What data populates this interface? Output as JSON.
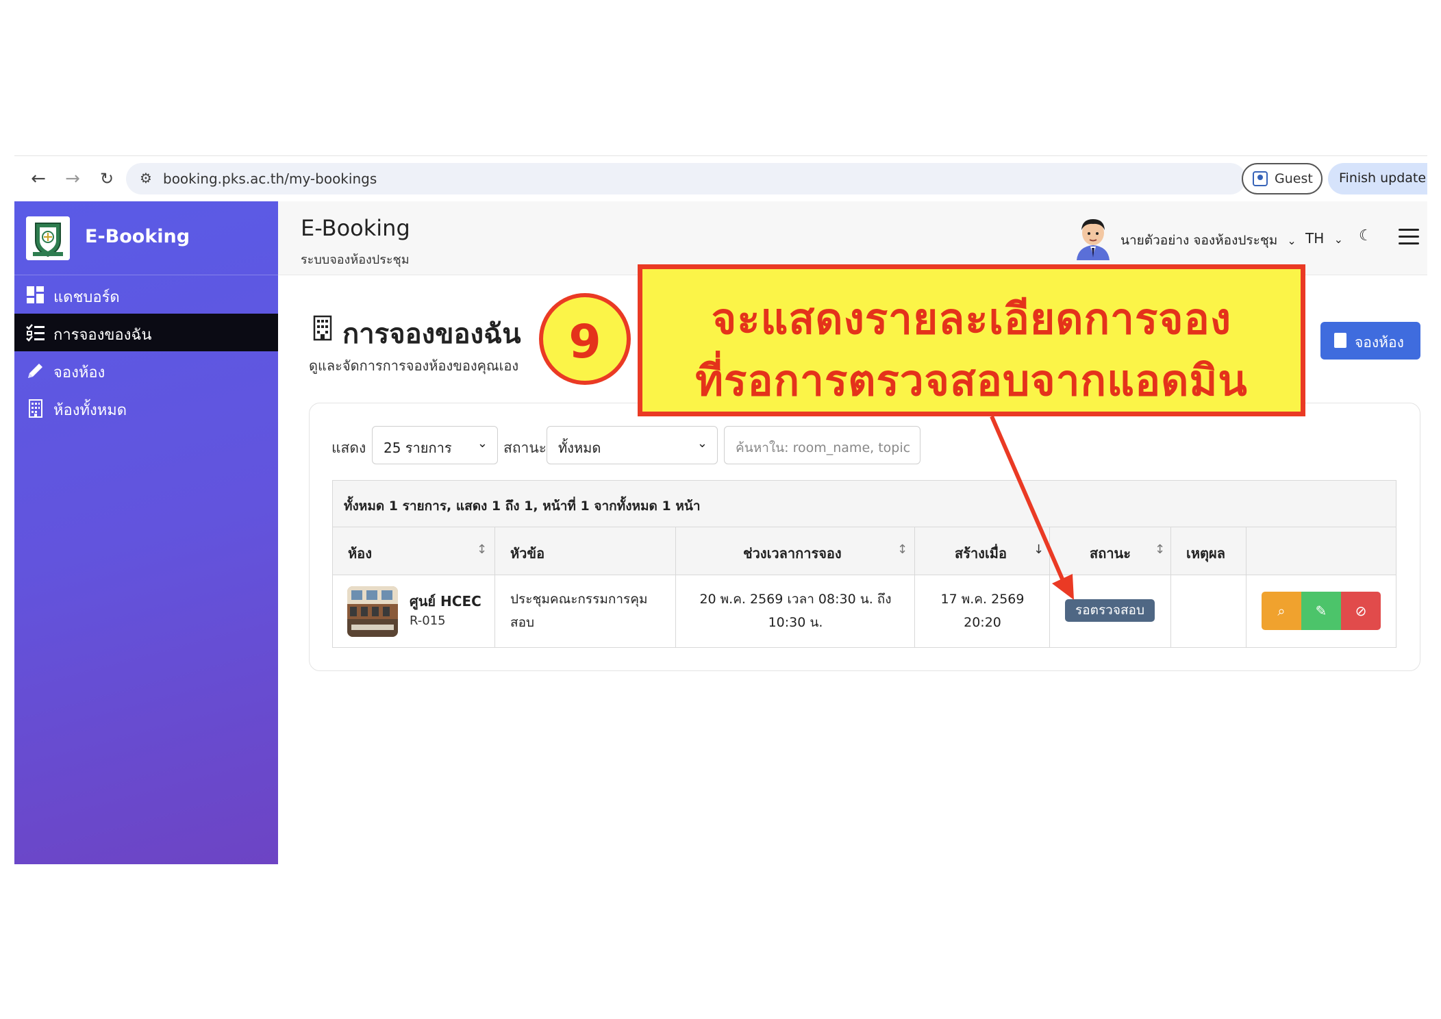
{
  "browser": {
    "url": "booking.pks.ac.th/my-bookings",
    "guest_label": "Guest",
    "finish_update_label": "Finish update"
  },
  "sidebar": {
    "brand": "E-Booking",
    "items": [
      {
        "label": "แดชบอร์ด",
        "icon": "dashboard-icon",
        "active": false
      },
      {
        "label": "การจองของฉัน",
        "icon": "checklist-icon",
        "active": true
      },
      {
        "label": "จองห้อง",
        "icon": "pencil-icon",
        "active": false
      },
      {
        "label": "ห้องทั้งหมด",
        "icon": "building-icon",
        "active": false
      }
    ]
  },
  "header": {
    "title": "E-Booking",
    "subtitle": "ระบบจองห้องประชุม",
    "user_name": "นายตัวอย่าง จองห้องประชุม",
    "language": "TH"
  },
  "main": {
    "title": "การจองของฉัน",
    "subtitle": "ดูและจัดการการจองห้องของคุณเอง",
    "book_button": "จองห้อง",
    "filters": {
      "show_label": "แสดง",
      "show_value": "25 รายการ",
      "status_label": "สถานะ",
      "status_value": "ทั้งหมด",
      "search_placeholder": "ค้นหาใน: room_name, topic"
    },
    "table": {
      "summary": "ทั้งหมด 1 รายการ, แสดง 1 ถึง 1, หน้าที่ 1 จากทั้งหมด 1 หน้า",
      "columns": [
        "ห้อง",
        "หัวข้อ",
        "ช่วงเวลาการจอง",
        "สร้างเมื่อ",
        "สถานะ",
        "เหตุผล",
        ""
      ],
      "rows": [
        {
          "room_name": "ศูนย์ HCEC",
          "room_code": "R-015",
          "topic_line1": "ประชุมคณะกรรมการคุม",
          "topic_line2": "สอบ",
          "period_line1": "20 พ.ค. 2569 เวลา 08:30 น. ถึง",
          "period_line2": "10:30 น.",
          "created_line1": "17 พ.ค. 2569",
          "created_line2": "20:20",
          "status": "รอตรวจสอบ",
          "reason": ""
        }
      ]
    }
  },
  "annotation": {
    "step": "9",
    "line1": "จะแสดงรายละเอียดการจอง",
    "line2": "ที่รอการตรวจสอบจากแอดมิน"
  },
  "colors": {
    "sidebar_start": "#5a5be6",
    "sidebar_end": "#6d44c4",
    "primary": "#3f6cde",
    "badge": "#4f6784",
    "view": "#f0a22e",
    "edit": "#4cc46a",
    "cancel": "#e14b4b",
    "annotation_fill": "#fbf448",
    "annotation_red": "#e4321b"
  }
}
